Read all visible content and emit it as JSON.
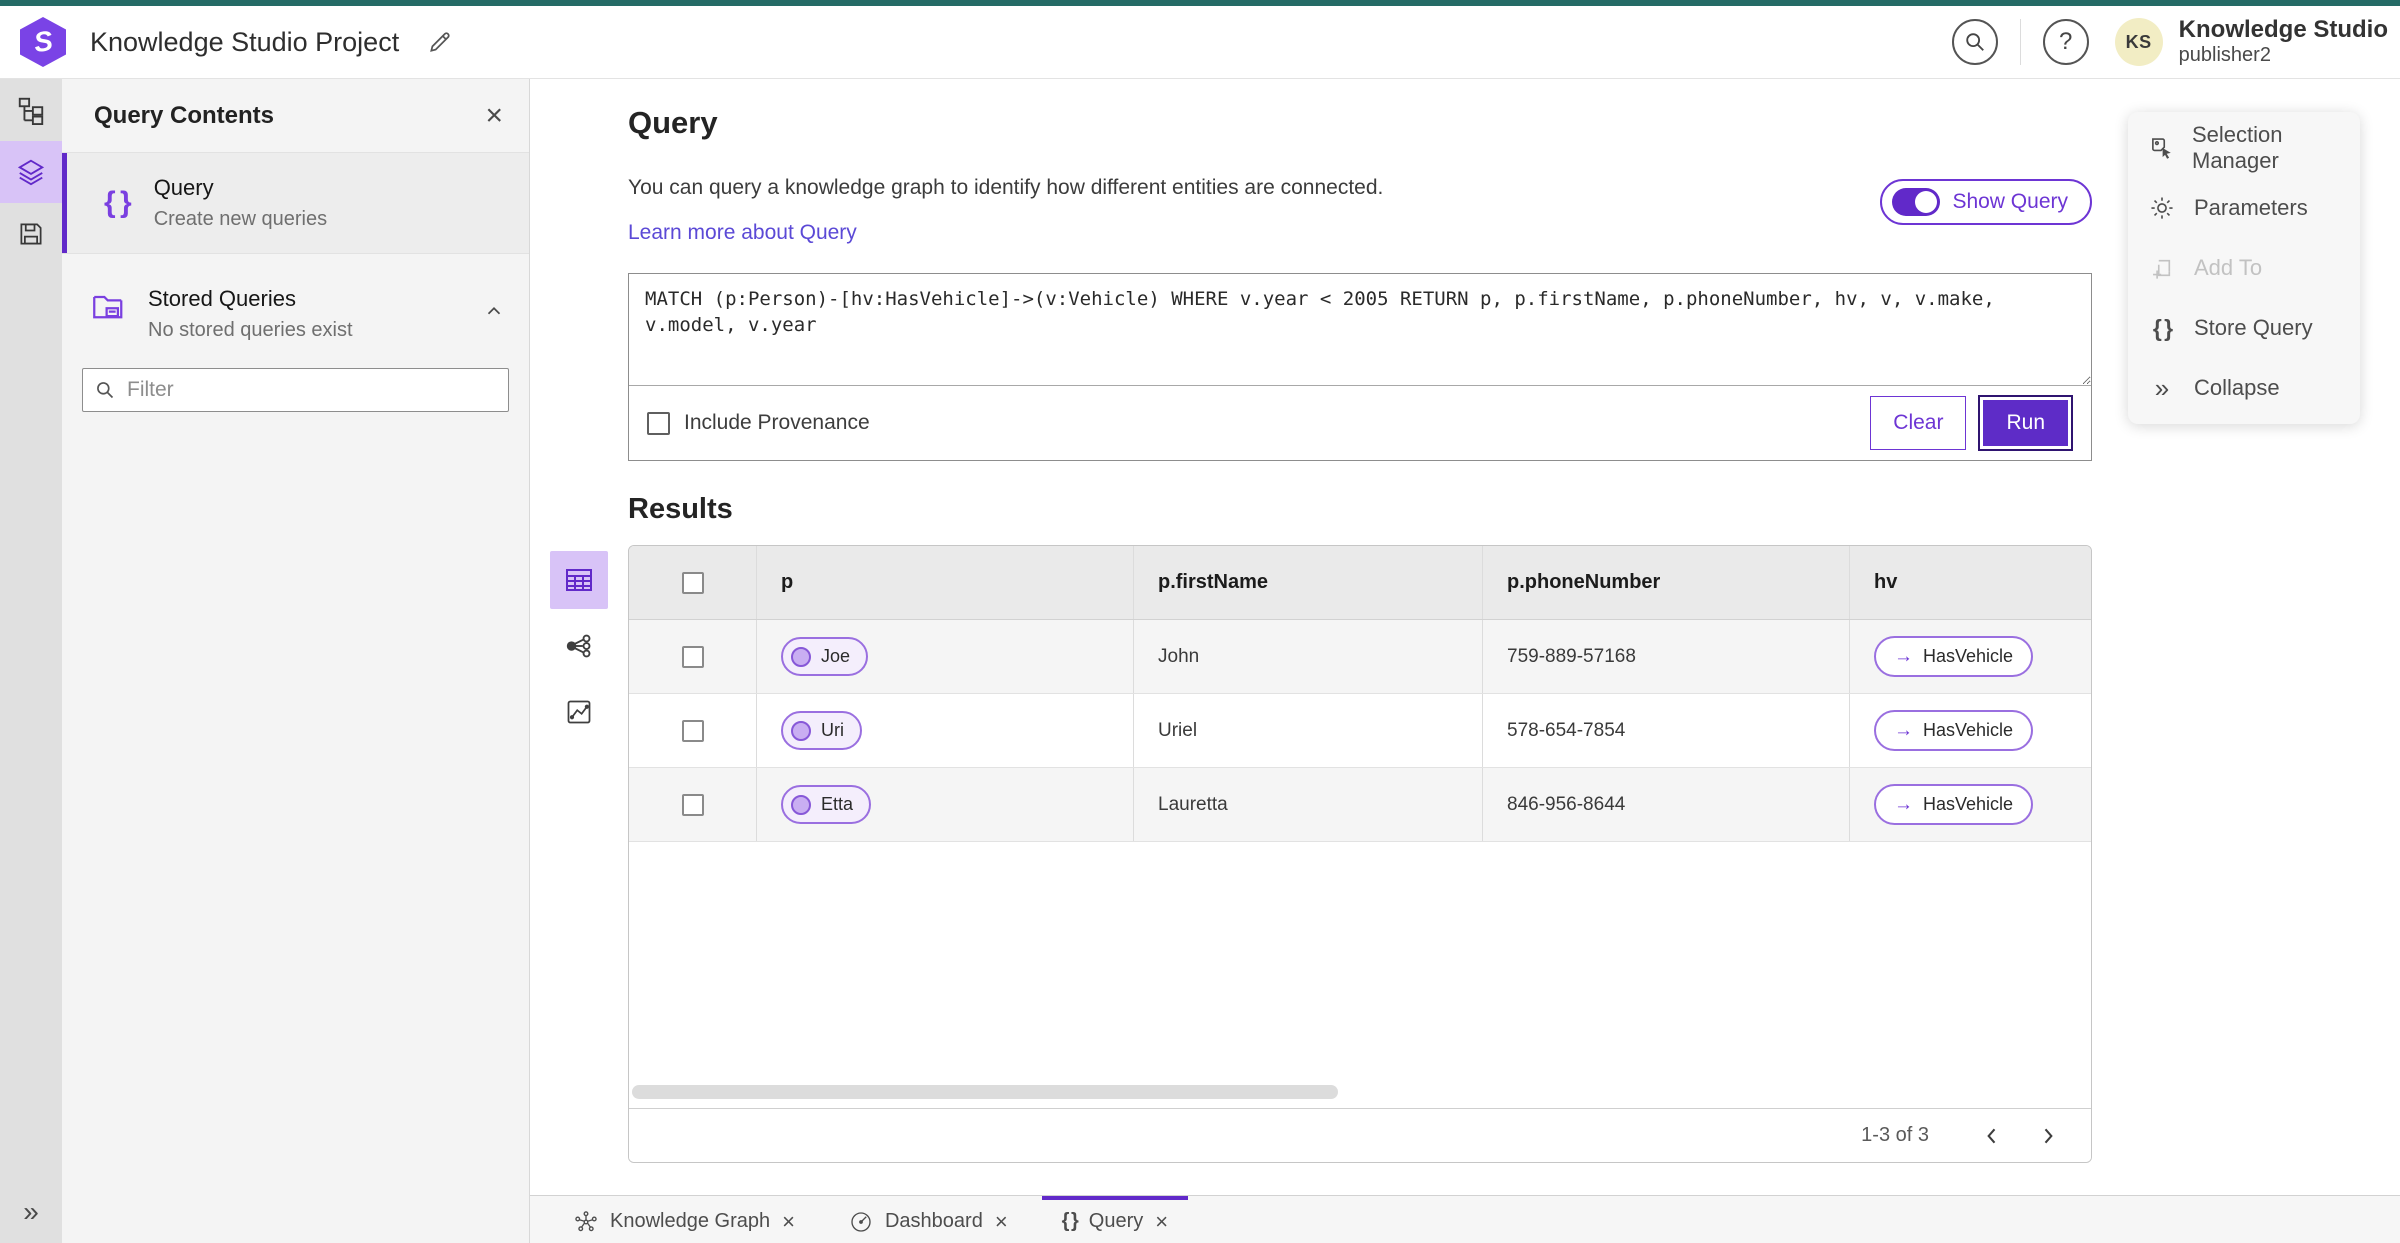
{
  "topbar": {
    "title": "Knowledge Studio Project",
    "user_initials": "KS",
    "user_name": "Knowledge Studio",
    "user_role": "publisher2"
  },
  "left_panel": {
    "title": "Query Contents",
    "query_item": {
      "title": "Query",
      "subtitle": "Create new queries"
    },
    "stored_item": {
      "title": "Stored Queries",
      "subtitle": "No stored queries exist"
    },
    "filter_placeholder": "Filter"
  },
  "main": {
    "heading": "Query",
    "description": "You can query a knowledge graph to identify how different entities are connected.",
    "learn_more": "Learn more about Query",
    "show_query_label": "Show Query",
    "query_text": "MATCH (p:Person)-[hv:HasVehicle]->(v:Vehicle) WHERE v.year < 2005 RETURN p, p.firstName, p.phoneNumber, hv, v, v.make, v.model, v.year",
    "include_provenance": "Include Provenance",
    "clear_label": "Clear",
    "run_label": "Run",
    "results_heading": "Results"
  },
  "table": {
    "columns": [
      "p",
      "p.firstName",
      "p.phoneNumber",
      "hv"
    ],
    "rows": [
      {
        "p": "Joe",
        "firstName": "John",
        "phoneNumber": "759-889-57168",
        "hv": "HasVehicle"
      },
      {
        "p": "Uri",
        "firstName": "Uriel",
        "phoneNumber": "578-654-7854",
        "hv": "HasVehicle"
      },
      {
        "p": "Etta",
        "firstName": "Lauretta",
        "phoneNumber": "846-956-8644",
        "hv": "HasVehicle"
      }
    ],
    "pagination": "1-3 of 3"
  },
  "context_menu": {
    "items": [
      {
        "label": "Selection Manager",
        "disabled": false
      },
      {
        "label": "Parameters",
        "disabled": false
      },
      {
        "label": "Add To",
        "disabled": true
      },
      {
        "label": "Store Query",
        "disabled": false
      },
      {
        "label": "Collapse",
        "disabled": false
      }
    ]
  },
  "tabs": [
    {
      "label": "Knowledge Graph",
      "active": false
    },
    {
      "label": "Dashboard",
      "active": false
    },
    {
      "label": "Query",
      "active": true
    }
  ],
  "icons": {
    "braces": "{ }",
    "close": "×",
    "collapse": "»",
    "edge_arrow": "→",
    "help": "?",
    "logo_letter": "S"
  },
  "colors": {
    "accent_purple": "#6129c9",
    "accent_light": "#d8c3f7",
    "top_line_teal": "#256b66",
    "link": "#5b49d6",
    "avatar_bg": "#f2edc4"
  }
}
